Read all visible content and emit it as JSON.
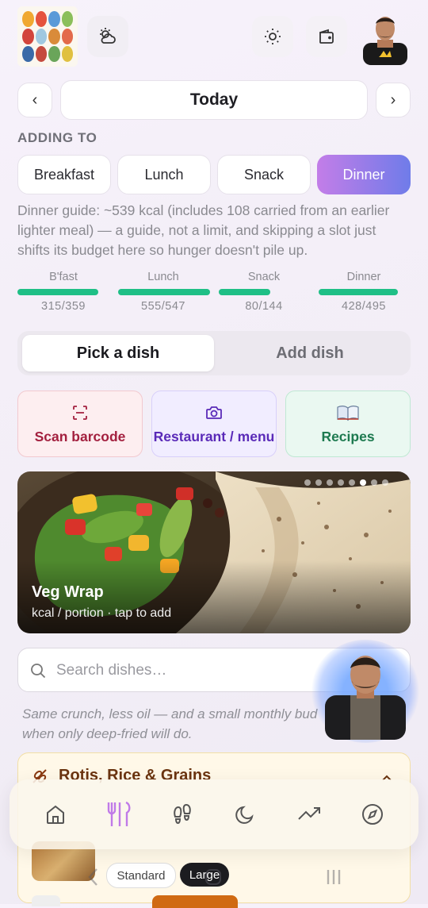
{
  "date_nav": {
    "prev": "‹",
    "title": "Today",
    "next": "›"
  },
  "adding_to": {
    "label": "ADDING TO",
    "meals": [
      "Breakfast",
      "Lunch",
      "Snack",
      "Dinner"
    ],
    "active": "Dinner"
  },
  "guide_text": "Dinner guide: ~539 kcal (includes 108 carried from an earlier lighter meal) — a guide, not a limit, and skipping a slot just shifts its budget here so hunger doesn't pile up.",
  "budgets": [
    {
      "label": "B'fast",
      "value": "315/359",
      "fill": 0.88
    },
    {
      "label": "Lunch",
      "value": "555/547",
      "fill": 1.0
    },
    {
      "label": "Snack",
      "value": "80/144",
      "fill": 0.56
    },
    {
      "label": "Dinner",
      "value": "428/495",
      "fill": 0.86
    }
  ],
  "tabs": {
    "active": "Pick a dish",
    "inactive": "Add dish"
  },
  "actions": {
    "scan": "Scan barcode",
    "restaurant": "Restaurant / menu",
    "recipes": "Recipes"
  },
  "hero": {
    "title": "Veg Wrap",
    "subtitle": "kcal / portion · tap to add",
    "dots": 8,
    "active_dot": 5
  },
  "search": {
    "placeholder": "Search dishes…"
  },
  "note": "Same crunch, less oil — and a small monthly bud when only deep-fried will do.",
  "category": {
    "title": "Rotis, Rice & Grains"
  },
  "portion": {
    "standard": "Standard",
    "large": "Large"
  },
  "colors": {
    "accent_start": "#c37de8",
    "accent_end": "#6f7ce9",
    "progress": "#1fbf86"
  },
  "bottom_nav": [
    "home-icon",
    "fork-knife-icon",
    "footprints-icon",
    "moon-icon",
    "trend-icon",
    "compass-icon"
  ]
}
